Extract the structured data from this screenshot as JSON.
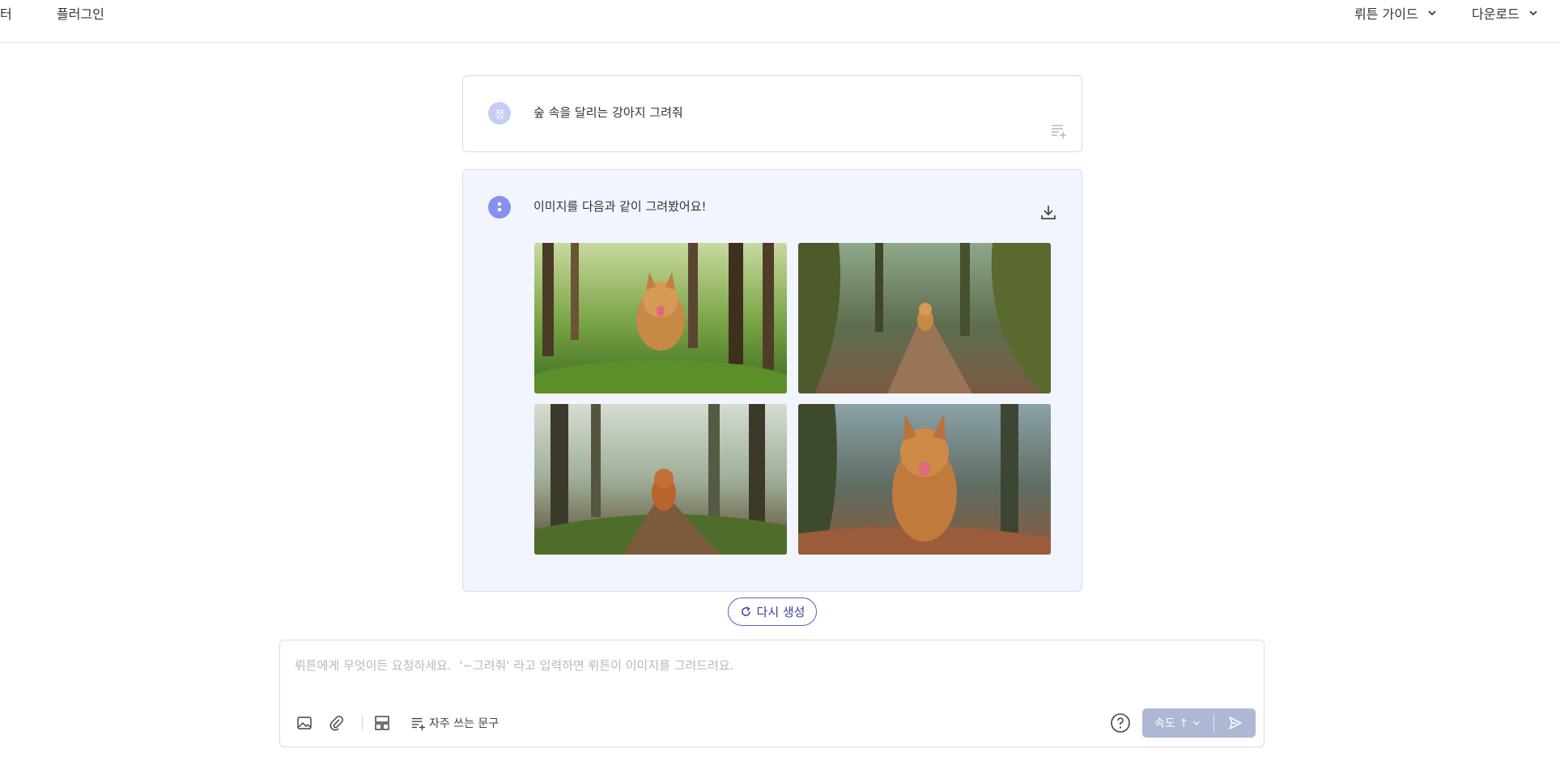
{
  "nav": {
    "left": [
      {
        "label": "터"
      },
      {
        "label": "플러그인"
      }
    ],
    "right": [
      {
        "label": "뤼튼 가이드",
        "icon": "chevron-down-icon"
      },
      {
        "label": "다운로드",
        "icon": "chevron-down-icon"
      }
    ]
  },
  "conversation": {
    "user_message": {
      "avatar": "정",
      "text": "숲 속을 달리는 강아지 그려줘",
      "icon": "add-to-phrases-icon"
    },
    "bot_message": {
      "text": "이미지를 다음과 같이 그려봤어요!",
      "icon": "download-icon",
      "images": [
        {
          "alt": "forest-dog-1"
        },
        {
          "alt": "forest-dog-2"
        },
        {
          "alt": "forest-dog-3"
        },
        {
          "alt": "forest-dog-4"
        }
      ]
    },
    "regenerate_label": "다시 생성"
  },
  "composer": {
    "placeholder": "뤼튼에게 무엇이든 요청하세요.  '~그려줘' 라고 입력하면 뤼튼이 이미지를 그려드려요.",
    "value": "",
    "tools": [
      "image-icon",
      "paperclip-icon",
      "template-icon"
    ],
    "phrases_label": "자주 쓰는 문구",
    "speed_label": "속도 ↑",
    "help_icon": "help-icon",
    "send_icon": "send-icon"
  },
  "colors": {
    "accent": "#5b5fc7",
    "bot_bg": "#f2f5fd",
    "send_bg": "#aeb7d4",
    "border": "#d9dce3"
  }
}
